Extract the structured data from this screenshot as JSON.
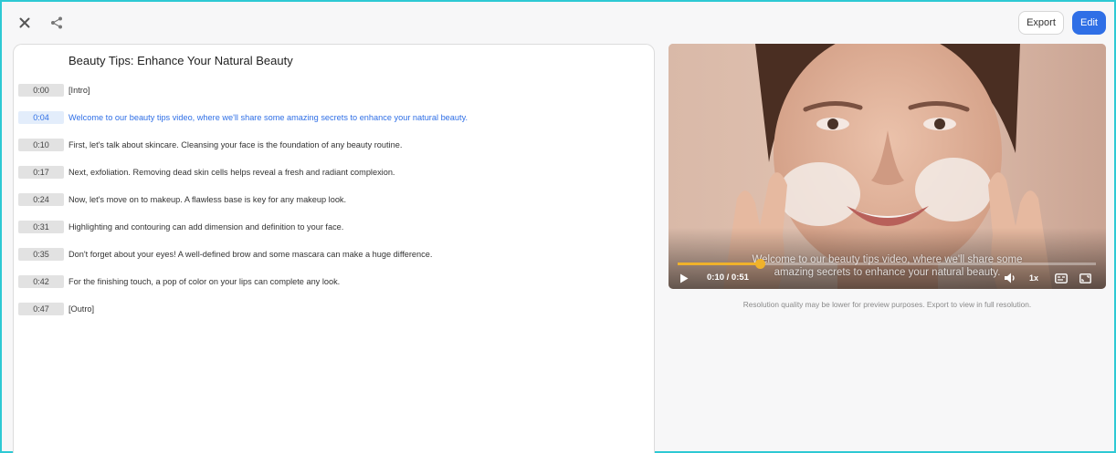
{
  "toolbar": {
    "close_icon": "close-icon",
    "share_icon": "share-icon",
    "export_label": "Export",
    "edit_label": "Edit",
    "accent_color": "#2f6fe6"
  },
  "transcript": {
    "title": "Beauty Tips: Enhance Your Natural Beauty",
    "rows": [
      {
        "time": "0:00",
        "text": "[Intro]"
      },
      {
        "time": "0:04",
        "text": "Welcome to our beauty tips video, where we'll share some amazing secrets to enhance your natural beauty."
      },
      {
        "time": "0:10",
        "text": "First, let's talk about skincare. Cleansing your face is the foundation of any beauty routine."
      },
      {
        "time": "0:17",
        "text": "Next, exfoliation. Removing dead skin cells helps reveal a fresh and radiant complexion."
      },
      {
        "time": "0:24",
        "text": "Now, let's move on to makeup. A flawless base is key for any makeup look."
      },
      {
        "time": "0:31",
        "text": "Highlighting and contouring can add dimension and definition to your face."
      },
      {
        "time": "0:35",
        "text": "Don't forget about your eyes! A well-defined brow and some mascara can make a huge difference."
      },
      {
        "time": "0:42",
        "text": "For the finishing touch, a pop of color on your lips can complete any look."
      },
      {
        "time": "0:47",
        "text": "[Outro]"
      }
    ],
    "active_index": 1
  },
  "player": {
    "caption_line1": "Welcome to our beauty tips video, where we'll share some",
    "caption_line2": "amazing secrets to enhance your natural beauty.",
    "timecode": "0:10 / 0:51",
    "progress_fraction": 0.196,
    "speed_label": "1x",
    "progress_color": "#f0b22b",
    "icons": [
      "play-icon",
      "volume-icon",
      "captions-icon",
      "fullscreen-icon"
    ]
  },
  "note": "Resolution quality may be lower for preview purposes. Export to view in full resolution."
}
